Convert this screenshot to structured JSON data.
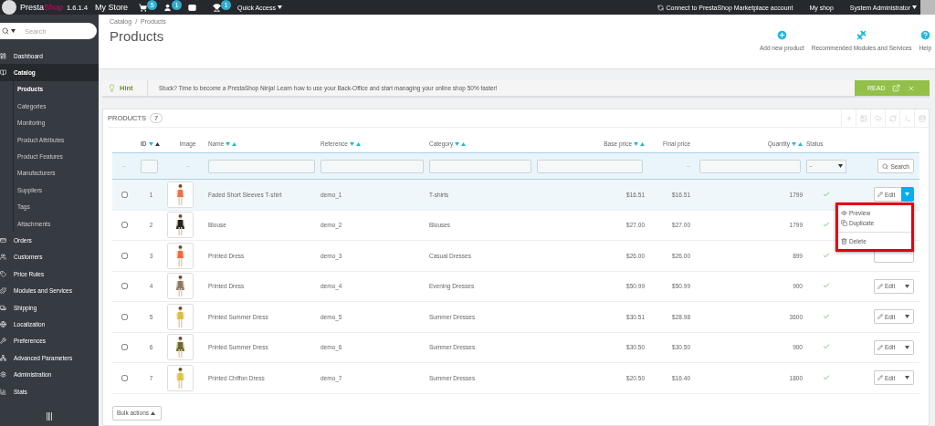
{
  "topbar": {
    "brand": {
      "first": "Presta",
      "second": "Shop"
    },
    "version": "1.6.1.4",
    "store": "My Store",
    "notifications": [
      {
        "kind": "cart",
        "count": "5"
      },
      {
        "kind": "customer",
        "count": "1"
      },
      {
        "kind": "message"
      },
      {
        "kind": "trophy",
        "count": "1"
      }
    ],
    "quick_access": "Quick Access",
    "connect": "Connect to PrestaShop Marketplace account",
    "my_shop": "My shop",
    "user": "System Administrator"
  },
  "sidebar": {
    "search": {
      "placeholder": "Search"
    },
    "items": [
      {
        "label": "Dashboard",
        "selected": false
      },
      {
        "label": "Catalog",
        "selected": true,
        "expanded": true,
        "children": [
          {
            "label": "Products",
            "selected": true
          },
          {
            "label": "Categories",
            "selected": false
          },
          {
            "label": "Monitoring",
            "selected": false
          },
          {
            "label": "Product Attributes",
            "selected": false
          },
          {
            "label": "Product Features",
            "selected": false
          },
          {
            "label": "Manufacturers",
            "selected": false
          },
          {
            "label": "Suppliers",
            "selected": false
          },
          {
            "label": "Tags",
            "selected": false
          },
          {
            "label": "Attachments",
            "selected": false
          }
        ]
      },
      {
        "label": "Orders",
        "selected": false
      },
      {
        "label": "Customers",
        "selected": false
      },
      {
        "label": "Price Rules",
        "selected": false
      },
      {
        "label": "Modules and Services",
        "selected": false
      },
      {
        "label": "Shipping",
        "selected": false
      },
      {
        "label": "Localization",
        "selected": false
      },
      {
        "label": "Preferences",
        "selected": false
      },
      {
        "label": "Advanced Parameters",
        "selected": false
      },
      {
        "label": "Administration",
        "selected": false
      },
      {
        "label": "Stats",
        "selected": false
      }
    ]
  },
  "page_header": {
    "breadcrumb": {
      "separator": "/",
      "items": [
        "Catalog",
        "Products"
      ]
    },
    "title": "Products",
    "toolbar": [
      {
        "kind": "add",
        "label": "Add new product"
      },
      {
        "kind": "modules",
        "label": "Recommended Modules and Services"
      },
      {
        "kind": "help",
        "label": "Help"
      }
    ]
  },
  "hint": {
    "title": "Hint",
    "text": "Stuck? Time to become a PrestaShop Ninja! Learn how to use your Back-Office and start managing your online shop 50% faster!",
    "action": "READ"
  },
  "panel": {
    "title": "PRODUCTS",
    "count": "7",
    "columns": [
      {
        "label": "ID",
        "sortable": true,
        "sorted": true
      },
      {
        "label": "Image",
        "sortable": false,
        "sorted": false
      },
      {
        "label": "Name",
        "sortable": true,
        "sorted": false
      },
      {
        "label": "Reference",
        "sortable": true,
        "sorted": false
      },
      {
        "label": "Category",
        "sortable": true,
        "sorted": false
      },
      {
        "label": "Base price",
        "sortable": true,
        "sorted": false
      },
      {
        "label": "Final price",
        "sortable": false,
        "sorted": false
      },
      {
        "label": "Quantity",
        "sortable": true,
        "sorted": false
      },
      {
        "label": "Status",
        "sortable": false,
        "sorted": false
      }
    ],
    "filters": {
      "empty_mark": "--",
      "status_value": "-",
      "search_button": "Search"
    },
    "rows": [
      {
        "id": "1",
        "name": "Faded Short Sleeves T-shirt",
        "reference": "demo_1",
        "category": "T-shirts",
        "base_price": "$16.51",
        "final_price": "$16.51",
        "quantity": "1799",
        "active": true,
        "highlighted": true,
        "edit": "Edit",
        "menu_open": true
      },
      {
        "id": "2",
        "name": "Blouse",
        "reference": "demo_2",
        "category": "Blouses",
        "base_price": "$27.00",
        "final_price": "$27.00",
        "quantity": "1799",
        "active": true,
        "highlighted": false,
        "covered": true
      },
      {
        "id": "3",
        "name": "Printed Dress",
        "reference": "demo_3",
        "category": "Casual Dresses",
        "base_price": "$26.00",
        "final_price": "$26.00",
        "quantity": "899",
        "active": true,
        "highlighted": false,
        "menu_open": false
      },
      {
        "id": "4",
        "name": "Printed Dress",
        "reference": "demo_4",
        "category": "Evening Dresses",
        "base_price": "$50.99",
        "final_price": "$50.99",
        "quantity": "900",
        "active": true,
        "highlighted": false,
        "edit": "Edit",
        "menu_open": false
      },
      {
        "id": "5",
        "name": "Printed Summer Dress",
        "reference": "demo_5",
        "category": "Summer Dresses",
        "base_price": "$30.51",
        "final_price": "$28.98",
        "quantity": "3600",
        "active": true,
        "highlighted": false,
        "edit": "Edit",
        "menu_open": false
      },
      {
        "id": "6",
        "name": "Printed Summer Dress",
        "reference": "demo_6",
        "category": "Summer Dresses",
        "base_price": "$30.50",
        "final_price": "$30.50",
        "quantity": "900",
        "active": true,
        "highlighted": false,
        "edit": "Edit",
        "menu_open": false
      },
      {
        "id": "7",
        "name": "Printed Chiffon Dress",
        "reference": "demo_7",
        "category": "Summer Dresses",
        "base_price": "$20.50",
        "final_price": "$16.40",
        "quantity": "1800",
        "active": true,
        "highlighted": false,
        "edit": "Edit",
        "menu_open": false
      }
    ],
    "row_menu": {
      "annotated": true,
      "items": [
        {
          "kind": "preview",
          "label": "Preview"
        },
        {
          "kind": "duplicate",
          "label": "Duplicate"
        },
        {
          "kind": "delete",
          "label": "Delete"
        }
      ]
    },
    "bulk_actions": "Bulk actions"
  }
}
